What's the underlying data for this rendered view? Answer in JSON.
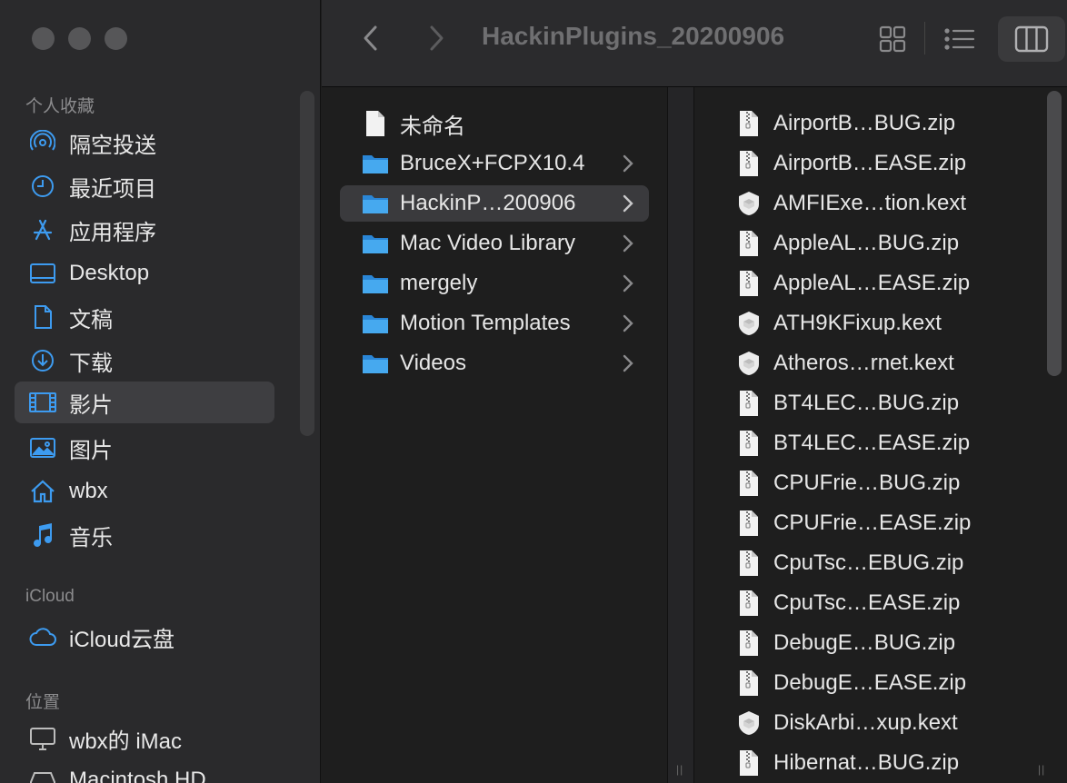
{
  "window": {
    "title": "HackinPlugins_20200906"
  },
  "sidebar": {
    "favorites_title": "个人收藏",
    "favorites": [
      {
        "label": "隔空投送",
        "icon": "airdrop-icon"
      },
      {
        "label": "最近项目",
        "icon": "clock-icon"
      },
      {
        "label": "应用程序",
        "icon": "applications-icon"
      },
      {
        "label": "Desktop",
        "icon": "desktop-icon"
      },
      {
        "label": "文稿",
        "icon": "document-icon"
      },
      {
        "label": "下载",
        "icon": "download-icon"
      },
      {
        "label": "影片",
        "icon": "film-icon",
        "selected": true
      },
      {
        "label": "图片",
        "icon": "photo-icon"
      },
      {
        "label": "wbx",
        "icon": "home-icon"
      },
      {
        "label": "音乐",
        "icon": "music-icon"
      }
    ],
    "icloud_title": "iCloud",
    "icloud": [
      {
        "label": "iCloud云盘",
        "icon": "cloud-icon"
      }
    ],
    "locations_title": "位置",
    "locations": [
      {
        "label": "wbx的 iMac",
        "icon": "imac-icon"
      },
      {
        "label": "Macintosh HD",
        "icon": "disk-icon"
      }
    ]
  },
  "column1": [
    {
      "name": "未命名",
      "type": "file"
    },
    {
      "name": "BruceX+FCPX10.4",
      "type": "folder"
    },
    {
      "name": "HackinP…200906",
      "type": "folder",
      "selected": true
    },
    {
      "name": "Mac Video Library",
      "type": "folder"
    },
    {
      "name": "mergely",
      "type": "folder"
    },
    {
      "name": "Motion Templates",
      "type": "folder"
    },
    {
      "name": "Videos",
      "type": "folder"
    }
  ],
  "column2": [
    {
      "name": "AirportB…BUG.zip",
      "type": "zip"
    },
    {
      "name": "AirportB…EASE.zip",
      "type": "zip"
    },
    {
      "name": "AMFIExe…tion.kext",
      "type": "kext"
    },
    {
      "name": "AppleAL…BUG.zip",
      "type": "zip"
    },
    {
      "name": "AppleAL…EASE.zip",
      "type": "zip"
    },
    {
      "name": "ATH9KFixup.kext",
      "type": "kext"
    },
    {
      "name": "Atheros…rnet.kext",
      "type": "kext"
    },
    {
      "name": "BT4LEC…BUG.zip",
      "type": "zip"
    },
    {
      "name": "BT4LEC…EASE.zip",
      "type": "zip"
    },
    {
      "name": "CPUFrie…BUG.zip",
      "type": "zip"
    },
    {
      "name": "CPUFrie…EASE.zip",
      "type": "zip"
    },
    {
      "name": "CpuTsc…EBUG.zip",
      "type": "zip"
    },
    {
      "name": "CpuTsc…EASE.zip",
      "type": "zip"
    },
    {
      "name": "DebugE…BUG.zip",
      "type": "zip"
    },
    {
      "name": "DebugE…EASE.zip",
      "type": "zip"
    },
    {
      "name": "DiskArbi…xup.kext",
      "type": "kext"
    },
    {
      "name": "Hibernat…BUG.zip",
      "type": "zip"
    }
  ],
  "colors": {
    "accent": "#2f8fe8",
    "folder": "#3aa0e8",
    "selected_row": "#3a3a3d",
    "sidebar_bg": "#2a2a2c"
  }
}
